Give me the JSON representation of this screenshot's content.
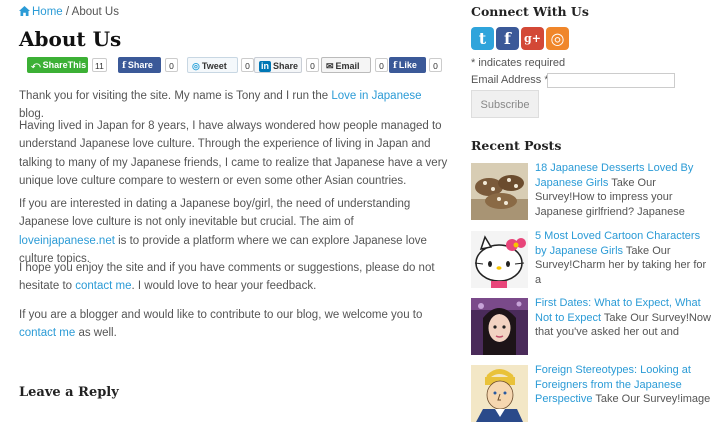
{
  "breadcrumb": {
    "home": "Home",
    "separator": "/",
    "current": "About Us"
  },
  "page_title": "About Us",
  "share_buttons": [
    {
      "label": "ShareThis",
      "count": "11",
      "color": "#3cb035",
      "icon": "share-icon"
    },
    {
      "label": "Share",
      "count": "0",
      "color": "#3b5998",
      "icon": "facebook-icon"
    },
    {
      "label": "Tweet",
      "count": "0",
      "color": "#f4f8fb",
      "icon": "twitter-icon"
    },
    {
      "label": "Share",
      "count": "0",
      "color": "#f4f6f8",
      "icon": "linkedin-icon"
    },
    {
      "label": "Email",
      "count": "0",
      "color": "#f5f5f5",
      "icon": "email-icon"
    },
    {
      "label": "Like",
      "count": "0",
      "color": "#3b5998",
      "icon": "facebook-like-icon"
    }
  ],
  "paragraphs": {
    "p1": {
      "t1": "Thank you for visiting the site. My name is Tony and I run the ",
      "link": "Love in Japanese",
      "t2": " blog."
    },
    "p2": "Having lived in Japan for 8 years, I have always wondered how people managed to understand Japanese love culture. Through the experience of living in Japan and talking to many of my Japanese friends, I came to realize that Japanese have a very unique love culture compare to western or even some other Asian countries.",
    "p3": {
      "t1": "If you are interested in dating a Japanese boy/girl, the need of understanding Japanese love culture is not only inevitable but crucial. The aim of ",
      "link": "loveinjapanese.net",
      "t2": " is to provide a platform where we can explore Japanese love culture topics."
    },
    "p4": {
      "t1": "I hope you enjoy the site and if you have comments or suggestions, please do not hesitate to ",
      "link": "contact me",
      "t2": ". I would love to hear your feedback."
    },
    "p5": {
      "t1": "If you are a blogger and would like to contribute to our blog, we welcome you to ",
      "link": "contact me",
      "t2": " as well."
    }
  },
  "leave_reply": "Leave a Reply",
  "sidebar": {
    "connect_title": "Connect With Us",
    "social_icons": [
      {
        "icon": "twitter-icon",
        "glyph": "t",
        "color": "#2fa4db"
      },
      {
        "icon": "facebook-icon",
        "glyph": "f",
        "color": "#3b5998"
      },
      {
        "icon": "google-plus-icon",
        "glyph": "g+",
        "color": "#d34836"
      },
      {
        "icon": "rss-icon",
        "glyph": "◎",
        "color": "#f0862a"
      }
    ],
    "required_note": "* indicates required",
    "email_label": "Email Address *",
    "email_value": "",
    "subscribe_label": "Subscribe",
    "recent_title": "Recent Posts",
    "posts": [
      {
        "title": "18 Japanese Desserts Loved By Japanese Girls",
        "excerpt": " Take Our Survey!How to impress your Japanese girlfriend? Japanese"
      },
      {
        "title": "5 Most Loved Cartoon Characters by Japanese Girls",
        "excerpt": " Take Our Survey!Charm her by taking her for a"
      },
      {
        "title": "First Dates: What to Expect, What Not to Expect",
        "excerpt": " Take Our Survey!Now that you've asked her out and"
      },
      {
        "title": "Foreign Stereotypes: Looking at Foreigners from the Japanese Perspective",
        "excerpt": " Take Our Survey!image"
      }
    ]
  }
}
